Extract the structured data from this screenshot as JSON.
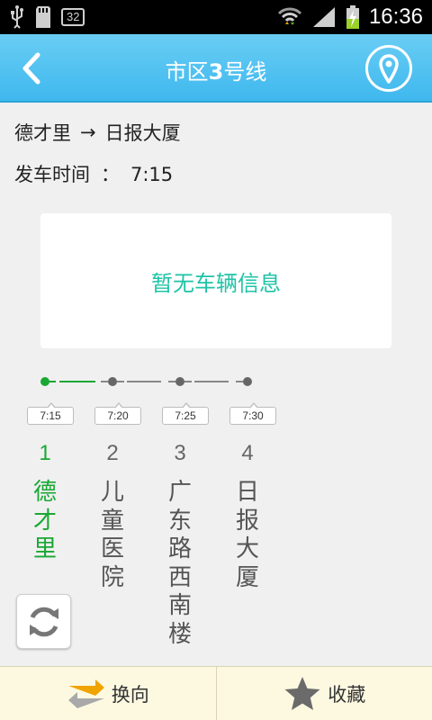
{
  "status_bar": {
    "time": "16:36",
    "badge": "32"
  },
  "header": {
    "title_prefix": "市区",
    "title_number": "3",
    "title_suffix": "号线"
  },
  "route": {
    "from": "德才里",
    "arrow": "→",
    "to": "日报大厦"
  },
  "departure": {
    "label": "发车时间",
    "separator": "：",
    "time": "7:15"
  },
  "message": "暂无车辆信息",
  "stops": [
    {
      "index": "1",
      "name": "德才里",
      "time": "7:15",
      "active": true
    },
    {
      "index": "2",
      "name": "儿童医院",
      "time": "7:20",
      "active": false
    },
    {
      "index": "3",
      "name": "广东路西南楼",
      "time": "7:25",
      "active": false
    },
    {
      "index": "4",
      "name": "日报大厦",
      "time": "7:30",
      "active": false
    }
  ],
  "bottom_bar": {
    "reverse_label": "换向",
    "favorite_label": "收藏"
  },
  "colors": {
    "accent": "#3fb8ee",
    "active": "#1aa833",
    "message": "#1fc3a7",
    "bottom_bar": "#fdf9e1"
  }
}
